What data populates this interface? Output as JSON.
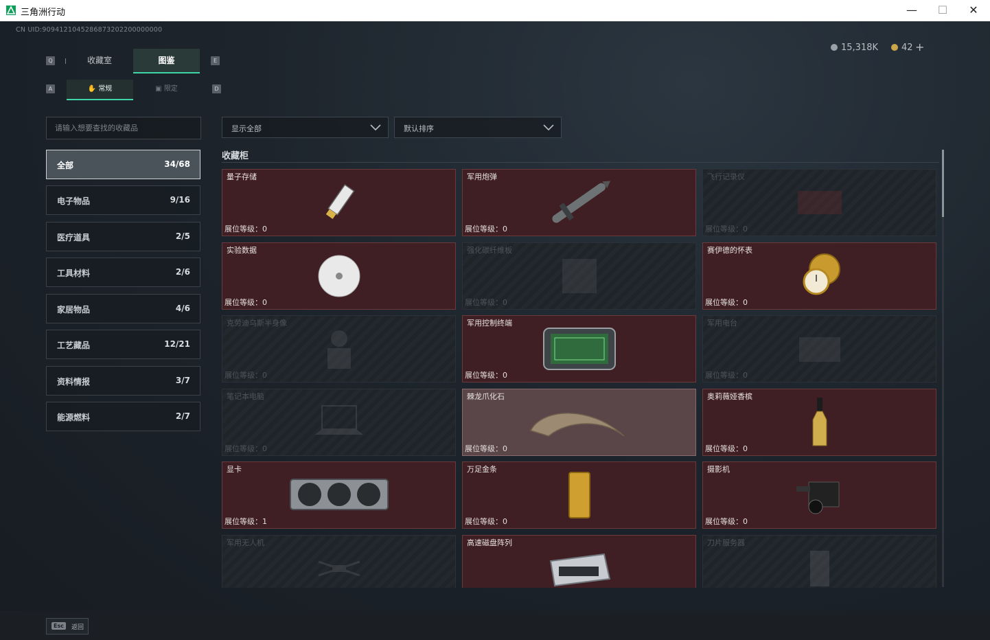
{
  "window": {
    "title": "三角洲行动"
  },
  "uid": "CN UID:9094121045286873202200000000",
  "currency": {
    "coins": "15,318K",
    "tokens": "42",
    "plus": "+"
  },
  "keys": {
    "q": "Q",
    "e": "E",
    "a": "A",
    "d": "D"
  },
  "tabs": {
    "collection": "收藏室",
    "guide": "图鉴"
  },
  "subtabs": {
    "regular": "常规",
    "limited": "限定"
  },
  "search": {
    "placeholder": "请输入想要查找的收藏品"
  },
  "categories": [
    {
      "label": "全部",
      "count": "34/68"
    },
    {
      "label": "电子物品",
      "count": "9/16"
    },
    {
      "label": "医疗道具",
      "count": "2/5"
    },
    {
      "label": "工具材料",
      "count": "2/6"
    },
    {
      "label": "家居物品",
      "count": "4/6"
    },
    {
      "label": "工艺藏品",
      "count": "12/21"
    },
    {
      "label": "资料情报",
      "count": "3/7"
    },
    {
      "label": "能源燃料",
      "count": "2/7"
    }
  ],
  "filters": {
    "show": "显示全部",
    "sort": "默认排序"
  },
  "section_title": "收藏柜",
  "level_prefix": "展位等级：",
  "items": [
    {
      "name": "量子存储",
      "level": "展位等级：0",
      "icon": "usb-drive-icon"
    },
    {
      "name": "军用炮弹",
      "level": "展位等级：0",
      "icon": "missile-icon"
    },
    {
      "name": "飞行记录仪",
      "level": "展位等级：0",
      "icon": "flight-recorder-icon"
    },
    {
      "name": "实验数据",
      "level": "展位等级：0",
      "icon": "disc-icon"
    },
    {
      "name": "强化碳纤维板",
      "level": "展位等级：0",
      "icon": "carbon-plate-icon"
    },
    {
      "name": "赛伊德的怀表",
      "level": "展位等级：0",
      "icon": "pocket-watch-icon"
    },
    {
      "name": "克劳迪乌斯半身像",
      "level": "展位等级：0",
      "icon": "bust-icon"
    },
    {
      "name": "军用控制终端",
      "level": "展位等级：0",
      "icon": "control-terminal-icon"
    },
    {
      "name": "军用电台",
      "level": "展位等级：0",
      "icon": "radio-icon"
    },
    {
      "name": "笔记本电脑",
      "level": "展位等级：0",
      "icon": "laptop-icon"
    },
    {
      "name": "棘龙爪化石",
      "level": "展位等级：0",
      "icon": "claw-fossil-icon"
    },
    {
      "name": "奥莉薇娅香槟",
      "level": "展位等级：0",
      "icon": "champagne-icon"
    },
    {
      "name": "显卡",
      "level": "展位等级：1",
      "icon": "graphics-card-icon"
    },
    {
      "name": "万足金条",
      "level": "展位等级：0",
      "icon": "gold-bar-icon"
    },
    {
      "name": "摄影机",
      "level": "展位等级：0",
      "icon": "camera-icon"
    },
    {
      "name": "军用无人机",
      "level": "",
      "icon": "drone-icon"
    },
    {
      "name": "高速磁盘阵列",
      "level": "",
      "icon": "disk-array-icon"
    },
    {
      "name": "刀片服务器",
      "level": "",
      "icon": "blade-server-icon"
    }
  ],
  "footer": {
    "esc_key": "Esc",
    "back": "返回"
  },
  "colors": {
    "accent": "#3fd6a8",
    "card_owned": "#3f1f23",
    "card_border": "#6b3a3d"
  }
}
